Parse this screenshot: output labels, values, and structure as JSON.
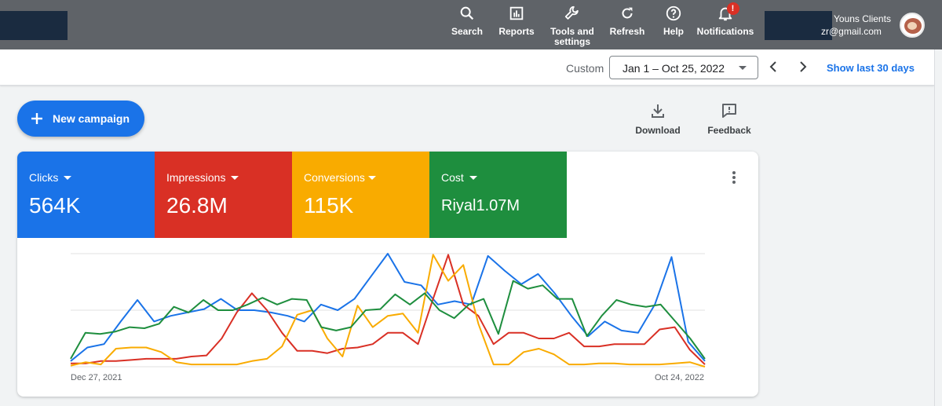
{
  "header": {
    "nav": [
      {
        "label": "Search",
        "icon": "search-icon"
      },
      {
        "label": "Reports",
        "icon": "reports-icon"
      },
      {
        "label": "Tools and\nsettings",
        "icon": "tools-icon"
      },
      {
        "label": "Refresh",
        "icon": "refresh-icon"
      },
      {
        "label": "Help",
        "icon": "help-icon"
      },
      {
        "label": "Notifications",
        "icon": "bell-icon",
        "badge": "!"
      }
    ],
    "account_name": "Youns Clients",
    "account_email": "zr@gmail.com"
  },
  "date_bar": {
    "range_type": "Custom",
    "range_value": "Jan 1 – Oct 25, 2022",
    "show_last": "Show last 30 days"
  },
  "actions": {
    "new_campaign": "New campaign",
    "download": "Download",
    "feedback": "Feedback"
  },
  "metrics": [
    {
      "label": "Clicks",
      "value": "564K",
      "color": "#1a73e8"
    },
    {
      "label": "Impressions",
      "value": "26.8M",
      "color": "#d93025"
    },
    {
      "label": "Conversions",
      "value": "115K",
      "color": "#f9ab00"
    },
    {
      "label": "Cost",
      "value": "Riyal1.07M",
      "color": "#1e8e3e"
    }
  ],
  "chart_data": {
    "type": "line",
    "x_start_label": "Dec 27, 2021",
    "x_end_label": "Oct 24, 2022",
    "ylim": [
      0,
      100
    ],
    "grid": true,
    "series": [
      {
        "name": "Clicks",
        "color": "#1a73e8",
        "values": [
          5,
          17,
          20,
          40,
          59,
          40,
          45,
          48,
          51,
          60,
          50,
          50,
          48,
          45,
          40,
          55,
          50,
          60,
          80,
          100,
          75,
          72,
          55,
          58,
          55,
          98,
          85,
          73,
          82,
          65,
          45,
          27,
          40,
          32,
          30,
          55,
          97,
          22,
          5
        ]
      },
      {
        "name": "Impressions",
        "color": "#d93025",
        "values": [
          3,
          3,
          5,
          5,
          6,
          7,
          7,
          7,
          9,
          10,
          25,
          48,
          65,
          50,
          30,
          14,
          14,
          12,
          16,
          17,
          20,
          30,
          30,
          20,
          60,
          99,
          55,
          45,
          20,
          30,
          30,
          25,
          25,
          30,
          18,
          18,
          20,
          20,
          20,
          33,
          35,
          15,
          2
        ]
      },
      {
        "name": "Conversions",
        "color": "#f9ab00",
        "values": [
          1,
          4,
          2,
          16,
          17,
          17,
          13,
          4,
          2,
          2,
          2,
          2,
          5,
          7,
          18,
          46,
          50,
          25,
          9,
          54,
          35,
          45,
          47,
          30,
          99,
          76,
          90,
          38,
          2,
          2,
          13,
          16,
          11,
          2,
          2,
          3,
          3,
          2,
          2,
          2,
          3,
          4,
          0
        ]
      },
      {
        "name": "Cost",
        "color": "#1e8e3e",
        "values": [
          7,
          30,
          29,
          31,
          35,
          34,
          38,
          53,
          48,
          59,
          50,
          50,
          55,
          61,
          55,
          60,
          59,
          35,
          32,
          35,
          50,
          51,
          64,
          55,
          65,
          50,
          43,
          55,
          60,
          29,
          76,
          69,
          72,
          60,
          60,
          27,
          45,
          59,
          55,
          53,
          55,
          40,
          25,
          7
        ]
      }
    ]
  }
}
